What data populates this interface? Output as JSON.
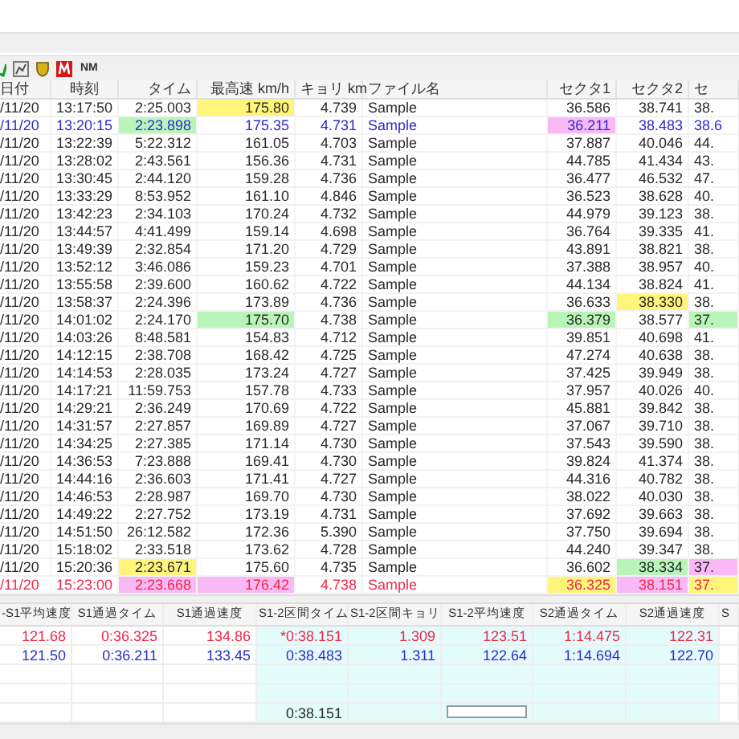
{
  "toolbar": {
    "label": "NM"
  },
  "table": {
    "columns": [
      "日付",
      "時刻",
      "タイム",
      "最高速 km/h",
      "キョリ km",
      "ファイル名",
      "セクタ1",
      "セクタ2",
      "セ"
    ],
    "rows": [
      {
        "kind": "plain",
        "cells": [
          "/11/20",
          "13:17:50",
          "2:25.003",
          {
            "text": "175.80",
            "color": "#fff57a"
          },
          "4.739",
          "Sample",
          "36.586",
          "38.741",
          "38."
        ]
      },
      {
        "kind": "best",
        "cells": [
          "/11/20",
          "13:20:15",
          {
            "text": "2:23.898",
            "color": "#b9f5b9"
          },
          "175.35",
          "4.731",
          "Sample",
          {
            "text": "36.211",
            "color": "#f9b9f5"
          },
          "38.483",
          "38.6"
        ]
      },
      {
        "kind": "plain",
        "cells": [
          "/11/20",
          "13:22:39",
          "5:22.312",
          "161.05",
          "4.703",
          "Sample",
          "37.887",
          "40.046",
          "44."
        ]
      },
      {
        "kind": "plain",
        "cells": [
          "/11/20",
          "13:28:02",
          "2:43.561",
          "156.36",
          "4.731",
          "Sample",
          "44.785",
          "41.434",
          "43."
        ]
      },
      {
        "kind": "plain",
        "cells": [
          "/11/20",
          "13:30:45",
          "2:44.120",
          "159.28",
          "4.736",
          "Sample",
          "36.477",
          "46.532",
          "47."
        ]
      },
      {
        "kind": "plain",
        "cells": [
          "/11/20",
          "13:33:29",
          "8:53.952",
          "161.10",
          "4.846",
          "Sample",
          "36.523",
          "38.628",
          "40."
        ]
      },
      {
        "kind": "plain",
        "cells": [
          "/11/20",
          "13:42:23",
          "2:34.103",
          "170.24",
          "4.732",
          "Sample",
          "44.979",
          "39.123",
          "38."
        ]
      },
      {
        "kind": "plain",
        "cells": [
          "/11/20",
          "13:44:57",
          "4:41.499",
          "159.14",
          "4.698",
          "Sample",
          "36.764",
          "39.335",
          "41."
        ]
      },
      {
        "kind": "plain",
        "cells": [
          "/11/20",
          "13:49:39",
          "2:32.854",
          "171.20",
          "4.729",
          "Sample",
          "43.891",
          "38.821",
          "38."
        ]
      },
      {
        "kind": "plain",
        "cells": [
          "/11/20",
          "13:52:12",
          "3:46.086",
          "159.23",
          "4.701",
          "Sample",
          "37.388",
          "38.957",
          "40."
        ]
      },
      {
        "kind": "plain",
        "cells": [
          "/11/20",
          "13:55:58",
          "2:39.600",
          "160.62",
          "4.722",
          "Sample",
          "44.134",
          "38.824",
          "41."
        ]
      },
      {
        "kind": "plain",
        "cells": [
          "/11/20",
          "13:58:37",
          "2:24.396",
          "173.89",
          "4.736",
          "Sample",
          "36.633",
          {
            "text": "38.330",
            "color": "#fff57a"
          },
          "38."
        ]
      },
      {
        "kind": "plain",
        "cells": [
          "/11/20",
          "14:01:02",
          "2:24.170",
          {
            "text": "175.70",
            "color": "#b9f5b9"
          },
          "4.738",
          "Sample",
          {
            "text": "36.379",
            "color": "#b9f5b9"
          },
          "38.577",
          {
            "text": "37.",
            "color": "#b9f5b9"
          }
        ]
      },
      {
        "kind": "plain",
        "cells": [
          "/11/20",
          "14:03:26",
          "8:48.581",
          "154.83",
          "4.712",
          "Sample",
          "39.851",
          "40.698",
          "41."
        ]
      },
      {
        "kind": "plain",
        "cells": [
          "/11/20",
          "14:12:15",
          "2:38.708",
          "168.42",
          "4.725",
          "Sample",
          "47.274",
          "40.638",
          "38."
        ]
      },
      {
        "kind": "plain",
        "cells": [
          "/11/20",
          "14:14:53",
          "2:28.035",
          "173.24",
          "4.727",
          "Sample",
          "37.425",
          "39.949",
          "38."
        ]
      },
      {
        "kind": "plain",
        "cells": [
          "/11/20",
          "14:17:21",
          "11:59.753",
          "157.78",
          "4.733",
          "Sample",
          "37.957",
          "40.026",
          "40."
        ]
      },
      {
        "kind": "plain",
        "cells": [
          "/11/20",
          "14:29:21",
          "2:36.249",
          "170.69",
          "4.722",
          "Sample",
          "45.881",
          "39.842",
          "38."
        ]
      },
      {
        "kind": "plain",
        "cells": [
          "/11/20",
          "14:31:57",
          "2:27.857",
          "169.89",
          "4.727",
          "Sample",
          "37.067",
          "39.710",
          "38."
        ]
      },
      {
        "kind": "plain",
        "cells": [
          "/11/20",
          "14:34:25",
          "2:27.385",
          "171.14",
          "4.730",
          "Sample",
          "37.543",
          "39.590",
          "38."
        ]
      },
      {
        "kind": "plain",
        "cells": [
          "/11/20",
          "14:36:53",
          "7:23.888",
          "169.41",
          "4.730",
          "Sample",
          "39.824",
          "41.374",
          "38."
        ]
      },
      {
        "kind": "plain",
        "cells": [
          "/11/20",
          "14:44:16",
          "2:36.603",
          "171.41",
          "4.727",
          "Sample",
          "44.316",
          "40.782",
          "38."
        ]
      },
      {
        "kind": "plain",
        "cells": [
          "/11/20",
          "14:46:53",
          "2:28.987",
          "169.70",
          "4.730",
          "Sample",
          "38.022",
          "40.030",
          "38."
        ]
      },
      {
        "kind": "plain",
        "cells": [
          "/11/20",
          "14:49:22",
          "2:27.752",
          "173.19",
          "4.731",
          "Sample",
          "37.692",
          "39.663",
          "38."
        ]
      },
      {
        "kind": "plain",
        "cells": [
          "/11/20",
          "14:51:50",
          "26:12.582",
          "172.36",
          "5.390",
          "Sample",
          "37.750",
          "39.694",
          "38."
        ]
      },
      {
        "kind": "plain",
        "cells": [
          "/11/20",
          "15:18:02",
          "2:33.518",
          "173.62",
          "4.728",
          "Sample",
          "44.240",
          "39.347",
          "38."
        ]
      },
      {
        "kind": "plain",
        "cells": [
          "/11/20",
          "15:20:36",
          {
            "text": "2:23.671",
            "color": "#fff57a"
          },
          "175.60",
          "4.735",
          "Sample",
          "36.602",
          {
            "text": "38.334",
            "color": "#b9f5b9"
          },
          {
            "text": "37.",
            "color": "#f9b9f5"
          }
        ]
      },
      {
        "kind": "last",
        "cells": [
          "/11/20",
          "15:23:00",
          {
            "text": "2:23.668",
            "color": "#f9b9f5"
          },
          {
            "text": "176.42",
            "color": "#f9b9f5"
          },
          "4.738",
          "Sample",
          {
            "text": "36.325",
            "color": "#fff57a"
          },
          {
            "text": "38.151",
            "color": "#f9b9f5"
          },
          {
            "text": "37.",
            "color": "#fff57a"
          }
        ]
      }
    ]
  },
  "summary": {
    "columns": [
      {
        "label": "-S1平均速度"
      },
      {
        "label": "S1通過タイム"
      },
      {
        "label": "S1通過速度"
      },
      {
        "label": "S1-2区間タイム",
        "color": "#e4fbfb"
      },
      {
        "label": "S1-2区間キョリ",
        "color": "#e4fbfb"
      },
      {
        "label": "S1-2平均速度",
        "color": "#e4fbfb"
      },
      {
        "label": "S2通過タイム",
        "color": "#e4fbfb"
      },
      {
        "label": "S2通過速度",
        "color": "#e4fbfb"
      },
      {
        "label": "S"
      }
    ],
    "rows": [
      {
        "kind": "last",
        "cells": [
          "121.68",
          "0:36.325",
          "134.86",
          "*0:38.151",
          "1.309",
          "123.51",
          "1:14.475",
          "122.31",
          null
        ]
      },
      {
        "kind": "best",
        "cells": [
          "121.50",
          "0:36.211",
          "133.45",
          "0:38.483",
          "1.311",
          "122.64",
          "1:14.694",
          "122.70",
          null
        ]
      },
      {
        "kind": "blank"
      },
      {
        "kind": "blank"
      },
      {
        "kind": "plain",
        "cells": [
          null,
          null,
          null,
          "0:38.151",
          null,
          {
            "kind": "field"
          },
          null,
          null,
          null
        ]
      }
    ]
  }
}
